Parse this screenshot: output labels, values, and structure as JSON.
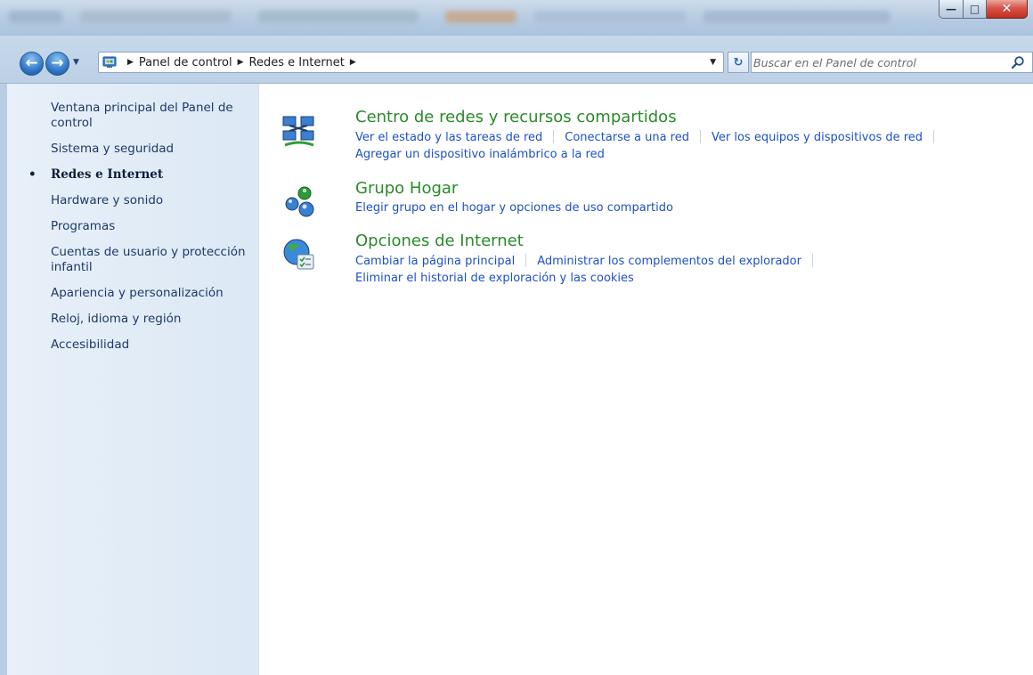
{
  "window": {
    "minimize_glyph": "—",
    "maximize_glyph": "□",
    "close_glyph": "✕"
  },
  "navbar": {
    "back_glyph": "←",
    "forward_glyph": "→",
    "history_glyph": "▼",
    "breadcrumbs": [
      "Panel de control",
      "Redes e Internet"
    ],
    "crumb_sep": "▶",
    "address_dropdown_glyph": "▼",
    "refresh_glyph": "↻",
    "search_placeholder": "Buscar en el Panel de control"
  },
  "sidebar": {
    "items": [
      {
        "label": "Ventana principal del Panel de control",
        "current": false
      },
      {
        "label": "Sistema y seguridad",
        "current": false
      },
      {
        "label": "Redes e Internet",
        "current": true
      },
      {
        "label": "Hardware y sonido",
        "current": false
      },
      {
        "label": "Programas",
        "current": false
      },
      {
        "label": "Cuentas de usuario y protección infantil",
        "current": false
      },
      {
        "label": "Apariencia y personalización",
        "current": false
      },
      {
        "label": "Reloj, idioma y región",
        "current": false
      },
      {
        "label": "Accesibilidad",
        "current": false
      }
    ],
    "bullet": "•"
  },
  "sections": [
    {
      "title": "Centro de redes y recursos compartidos",
      "icon": "network-center-icon",
      "lines": [
        [
          "Ver el estado y las tareas de red",
          "Conectarse a una red",
          "Ver los equipos y dispositivos de red"
        ],
        [
          "Agregar un dispositivo inalámbrico a la red"
        ]
      ]
    },
    {
      "title": "Grupo Hogar",
      "icon": "homegroup-icon",
      "lines": [
        [
          "Elegir grupo en el hogar y opciones de uso compartido"
        ]
      ]
    },
    {
      "title": "Opciones de Internet",
      "icon": "internet-options-icon",
      "lines": [
        [
          "Cambiar la página principal",
          "Administrar los complementos del explorador"
        ],
        [
          "Eliminar el historial de exploración y las cookies"
        ]
      ]
    }
  ],
  "colors": {
    "section_title": "#2a8a2a",
    "link": "#1e50c8",
    "sidebar_text": "#1e3966"
  }
}
